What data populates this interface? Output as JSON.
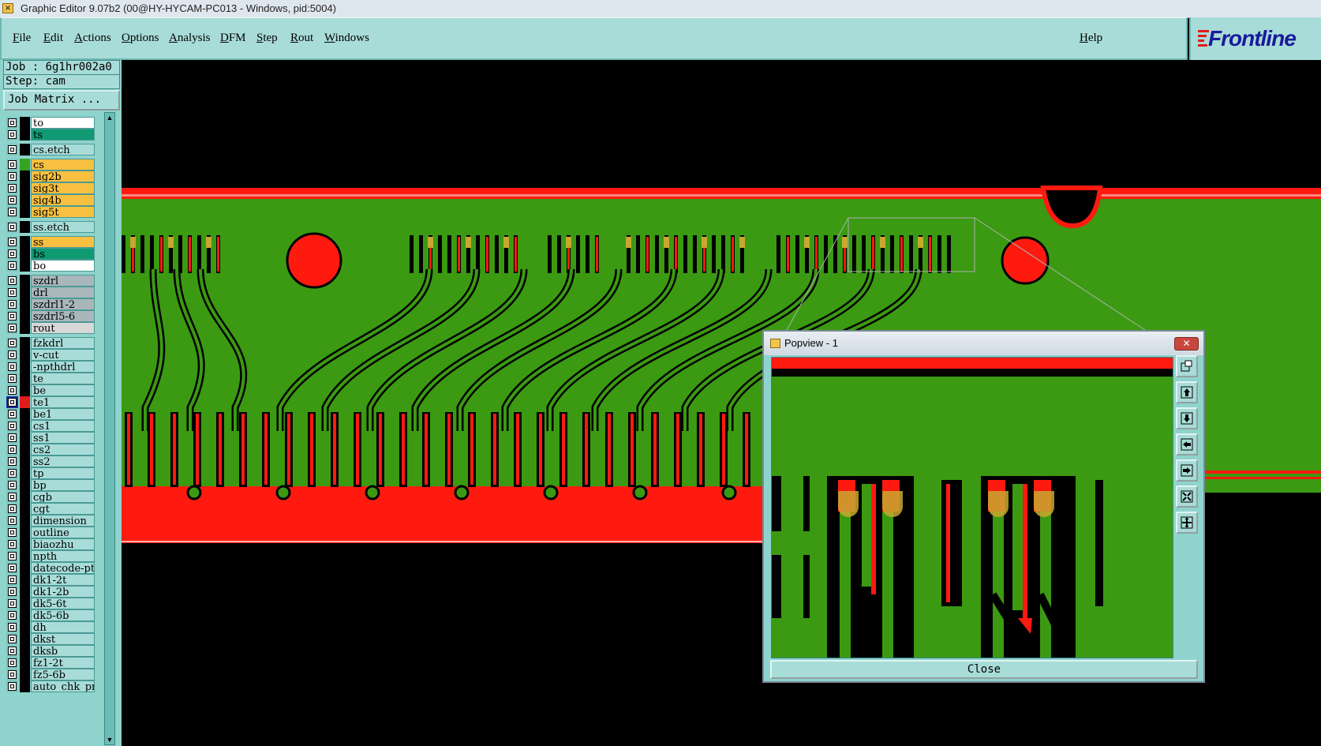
{
  "window": {
    "title": "Graphic Editor 9.07b2 (00@HY-HYCAM-PC013 - Windows, pid:5004)"
  },
  "menu": {
    "items": [
      "File",
      "Edit",
      "Actions",
      "Options",
      "Analysis",
      "DFM",
      "Step",
      "Rout",
      "Windows"
    ],
    "help": "Help"
  },
  "logo": {
    "text": "Frontline"
  },
  "job": {
    "name": "Job : 6g1hr002a0",
    "step": "Step: cam",
    "matrix_button": "Job Matrix ..."
  },
  "layers": [
    {
      "name": "to",
      "bg": "#ffffff",
      "sw": "#000000"
    },
    {
      "name": "ts",
      "bg": "#0f9a72",
      "sw": "#000000"
    },
    {
      "name": "cs.etch",
      "bg": "#a8dcd8",
      "sw": "#000000"
    },
    {
      "name": "cs",
      "bg": "#f8c040",
      "sw": "#34a320"
    },
    {
      "name": "sig2b",
      "bg": "#f8c040",
      "sw": "#000000"
    },
    {
      "name": "sig3t",
      "bg": "#f8c040",
      "sw": "#000000"
    },
    {
      "name": "sig4b",
      "bg": "#f8c040",
      "sw": "#000000"
    },
    {
      "name": "sig5t",
      "bg": "#f8c040",
      "sw": "#000000"
    },
    {
      "name": "ss.etch",
      "bg": "#a8dcd8",
      "sw": "#000000"
    },
    {
      "name": "ss",
      "bg": "#f8c040",
      "sw": "#000000"
    },
    {
      "name": "bs",
      "bg": "#0f9a72",
      "sw": "#000000"
    },
    {
      "name": "bo",
      "bg": "#ffffff",
      "sw": "#000000"
    },
    {
      "name": "szdrl",
      "bg": "#a9b7bb",
      "sw": "#000000"
    },
    {
      "name": "drl",
      "bg": "#a9b7bb",
      "sw": "#000000"
    },
    {
      "name": "szdrl1-2",
      "bg": "#a9b7bb",
      "sw": "#000000"
    },
    {
      "name": "szdrl5-6",
      "bg": "#a9b7bb",
      "sw": "#000000"
    },
    {
      "name": "rout",
      "bg": "#d8d8d8",
      "sw": "#000000"
    },
    {
      "name": "fzkdrl",
      "bg": "#a8dcd8",
      "sw": "#000000"
    },
    {
      "name": "v-cut",
      "bg": "#a8dcd8",
      "sw": "#000000"
    },
    {
      "name": "-npthdrl",
      "bg": "#a8dcd8",
      "sw": "#000000"
    },
    {
      "name": "te",
      "bg": "#a8dcd8",
      "sw": "#000000"
    },
    {
      "name": "be",
      "bg": "#a8dcd8",
      "sw": "#000000"
    },
    {
      "name": "te1",
      "bg": "#a8dcd8",
      "sw": "#e21b1b",
      "active": true
    },
    {
      "name": "be1",
      "bg": "#a8dcd8",
      "sw": "#000000"
    },
    {
      "name": "cs1",
      "bg": "#a8dcd8",
      "sw": "#000000"
    },
    {
      "name": "ss1",
      "bg": "#a8dcd8",
      "sw": "#000000"
    },
    {
      "name": "cs2",
      "bg": "#a8dcd8",
      "sw": "#000000"
    },
    {
      "name": "ss2",
      "bg": "#a8dcd8",
      "sw": "#000000"
    },
    {
      "name": "tp",
      "bg": "#a8dcd8",
      "sw": "#000000"
    },
    {
      "name": "bp",
      "bg": "#a8dcd8",
      "sw": "#000000"
    },
    {
      "name": "cgb",
      "bg": "#a8dcd8",
      "sw": "#000000"
    },
    {
      "name": "cgt",
      "bg": "#a8dcd8",
      "sw": "#000000"
    },
    {
      "name": "dimension",
      "bg": "#a8dcd8",
      "sw": "#000000"
    },
    {
      "name": "outline",
      "bg": "#a8dcd8",
      "sw": "#000000"
    },
    {
      "name": "biaozhu",
      "bg": "#a8dcd8",
      "sw": "#000000"
    },
    {
      "name": "npth",
      "bg": "#a8dcd8",
      "sw": "#000000"
    },
    {
      "name": "datecode-ptc",
      "bg": "#a8dcd8",
      "sw": "#000000"
    },
    {
      "name": "dk1-2t",
      "bg": "#a8dcd8",
      "sw": "#000000"
    },
    {
      "name": "dk1-2b",
      "bg": "#a8dcd8",
      "sw": "#000000"
    },
    {
      "name": "dk5-6t",
      "bg": "#a8dcd8",
      "sw": "#000000"
    },
    {
      "name": "dk5-6b",
      "bg": "#a8dcd8",
      "sw": "#000000"
    },
    {
      "name": "dh",
      "bg": "#a8dcd8",
      "sw": "#000000"
    },
    {
      "name": "dkst",
      "bg": "#a8dcd8",
      "sw": "#000000"
    },
    {
      "name": "dksb",
      "bg": "#a8dcd8",
      "sw": "#000000"
    },
    {
      "name": "fz1-2t",
      "bg": "#a8dcd8",
      "sw": "#000000"
    },
    {
      "name": "fz5-6b",
      "bg": "#a8dcd8",
      "sw": "#000000"
    },
    {
      "name": "auto_chk_pnl",
      "bg": "#a8dcd8",
      "sw": "#000000"
    }
  ],
  "popview": {
    "title": "Popview - 1",
    "close_label": "Close"
  },
  "colors": {
    "board": "#3b9a12",
    "copper": "#ff1a10",
    "pad": "#c8a830",
    "trace": "#000000"
  }
}
